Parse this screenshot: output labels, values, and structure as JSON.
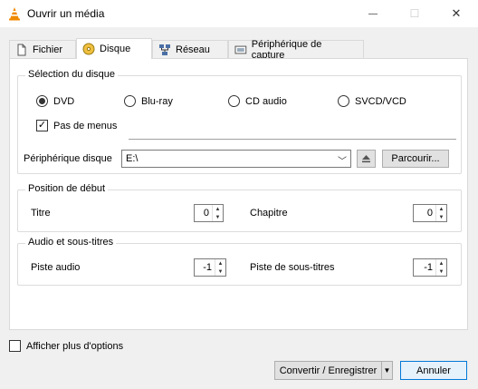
{
  "window": {
    "title": "Ouvrir un média",
    "minimize_glyph": "—",
    "maximize_glyph": "☐",
    "close_glyph": "✕"
  },
  "tabs": [
    {
      "label": "Fichier",
      "icon": "file-icon"
    },
    {
      "label": "Disque",
      "icon": "disc-icon"
    },
    {
      "label": "Réseau",
      "icon": "network-icon"
    },
    {
      "label": "Périphérique de capture",
      "icon": "capture-device-icon"
    }
  ],
  "disc_selection": {
    "title": "Sélection du disque",
    "options": [
      "DVD",
      "Blu-ray",
      "CD audio",
      "SVCD/VCD"
    ],
    "selected": "DVD",
    "no_menus_label": "Pas de menus",
    "no_menus_checked": true,
    "device_label": "Périphérique disque",
    "device_value": "E:\\",
    "browse_label": "Parcourir..."
  },
  "start_position": {
    "title": "Position de début",
    "title_label": "Titre",
    "title_value": "0",
    "chapter_label": "Chapitre",
    "chapter_value": "0"
  },
  "audio_subtitles": {
    "title": "Audio et sous-titres",
    "audio_label": "Piste audio",
    "audio_value": "-1",
    "subtitle_label": "Piste de sous-titres",
    "subtitle_value": "-1"
  },
  "footer": {
    "more_options_label": "Afficher plus d'options",
    "convert_label": "Convertir / Enregistrer",
    "cancel_label": "Annuler"
  }
}
